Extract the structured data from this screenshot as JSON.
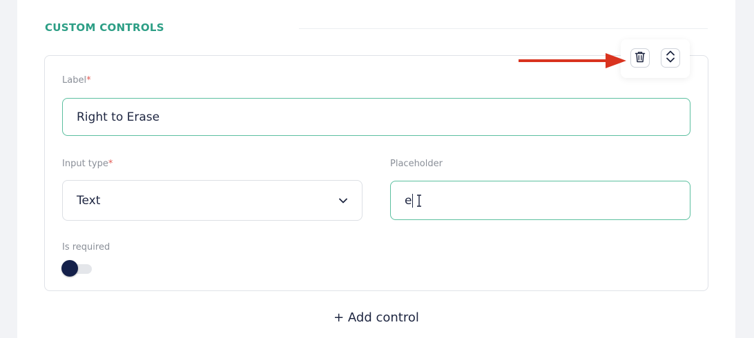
{
  "section": {
    "title": "CUSTOM CONTROLS"
  },
  "control": {
    "label_field": {
      "label": "Label",
      "required_mark": "*",
      "value": "Right to Erase"
    },
    "input_type_field": {
      "label": "Input type",
      "required_mark": "*",
      "selected": "Text"
    },
    "placeholder_field": {
      "label": "Placeholder",
      "value": "e"
    },
    "is_required": {
      "label": "Is required",
      "enabled": false
    },
    "actions": {
      "delete_icon": "trash-icon",
      "reorder_icon": "chevron-up-down-icon"
    }
  },
  "footer": {
    "add_control_label": "+ Add control"
  },
  "colors": {
    "accent": "#2c9e85",
    "input_focus_border": "#5bbf9f",
    "required": "#e25b55",
    "toggle_knob": "#14204a",
    "annotation_arrow": "#d9331f"
  }
}
